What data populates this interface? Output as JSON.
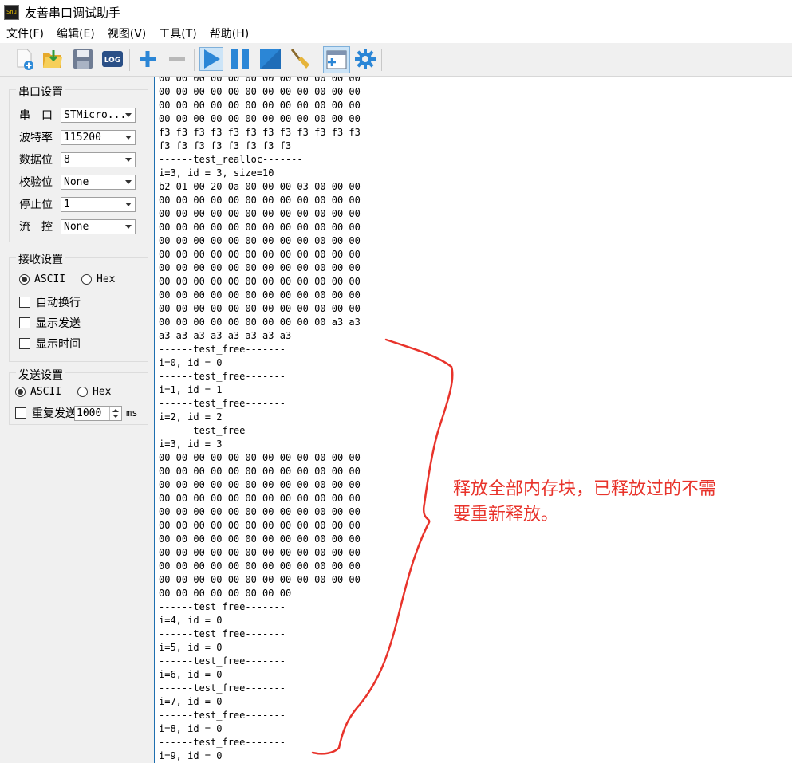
{
  "window": {
    "title": "友善串口调试助手",
    "icon_text": "Snu"
  },
  "menu": {
    "items": [
      "文件(F)",
      "编辑(E)",
      "视图(V)",
      "工具(T)",
      "帮助(H)"
    ]
  },
  "toolbar": {
    "buttons": [
      "new-file-icon",
      "open-folder-icon",
      "save-icon",
      "log-icon",
      "add-icon",
      "remove-icon",
      "start-icon",
      "pause-icon",
      "stop-icon",
      "clear-broom-icon",
      "add-window-icon",
      "settings-gear-icon"
    ],
    "log_label": "LOG"
  },
  "serial_settings": {
    "title": "串口设置",
    "port": {
      "label": "串　口",
      "value": "STMicro..."
    },
    "baud": {
      "label": "波特率",
      "value": "115200"
    },
    "data_bits": {
      "label": "数据位",
      "value": "8"
    },
    "parity": {
      "label": "校验位",
      "value": "None"
    },
    "stop_bits": {
      "label": "停止位",
      "value": "1"
    },
    "flow": {
      "label": "流　控",
      "value": "None"
    }
  },
  "receive_settings": {
    "title": "接收设置",
    "ascii": "ASCII",
    "hex": "Hex",
    "auto_wrap": "自动换行",
    "show_send": "显示发送",
    "show_time": "显示时间"
  },
  "send_settings": {
    "title": "发送设置",
    "ascii": "ASCII",
    "hex": "Hex",
    "repeat": "重复发送",
    "interval": "1000",
    "unit": "ms"
  },
  "receive_text": [
    "00 00 00 00 00 00 00 00 00 00 00 00",
    "00 00 00 00 00 00 00 00 00 00 00 00",
    "00 00 00 00 00 00 00 00 00 00 00 00",
    "00 00 00 00 00 00 00 00 00 00 00 00",
    "f3 f3 f3 f3 f3 f3 f3 f3 f3 f3 f3 f3",
    "f3 f3 f3 f3 f3 f3 f3 f3",
    "------test_realloc-------",
    "i=3, id = 3, size=10",
    "b2 01 00 20 0a 00 00 00 03 00 00 00",
    "00 00 00 00 00 00 00 00 00 00 00 00",
    "00 00 00 00 00 00 00 00 00 00 00 00",
    "00 00 00 00 00 00 00 00 00 00 00 00",
    "00 00 00 00 00 00 00 00 00 00 00 00",
    "00 00 00 00 00 00 00 00 00 00 00 00",
    "00 00 00 00 00 00 00 00 00 00 00 00",
    "00 00 00 00 00 00 00 00 00 00 00 00",
    "00 00 00 00 00 00 00 00 00 00 00 00",
    "00 00 00 00 00 00 00 00 00 00 00 00",
    "00 00 00 00 00 00 00 00 00 00 a3 a3",
    "a3 a3 a3 a3 a3 a3 a3 a3",
    "------test_free-------",
    "i=0, id = 0",
    "------test_free-------",
    "i=1, id = 1",
    "------test_free-------",
    "i=2, id = 2",
    "------test_free-------",
    "i=3, id = 3",
    "00 00 00 00 00 00 00 00 00 00 00 00",
    "00 00 00 00 00 00 00 00 00 00 00 00",
    "00 00 00 00 00 00 00 00 00 00 00 00",
    "00 00 00 00 00 00 00 00 00 00 00 00",
    "00 00 00 00 00 00 00 00 00 00 00 00",
    "00 00 00 00 00 00 00 00 00 00 00 00",
    "00 00 00 00 00 00 00 00 00 00 00 00",
    "00 00 00 00 00 00 00 00 00 00 00 00",
    "00 00 00 00 00 00 00 00 00 00 00 00",
    "00 00 00 00 00 00 00 00 00 00 00 00",
    "00 00 00 00 00 00 00 00",
    "------test_free-------",
    "i=4, id = 0",
    "------test_free-------",
    "i=5, id = 0",
    "------test_free-------",
    "i=6, id = 0",
    "------test_free-------",
    "i=7, id = 0",
    "------test_free-------",
    "i=8, id = 0",
    "------test_free-------",
    "i=9, id = 0"
  ],
  "annotation": {
    "line1": "释放全部内存块，已释放过的不需",
    "line2": "要重新释放。",
    "color": "#e8332b"
  },
  "colors": {
    "accent_blue": "#1e6fb0",
    "pressed_bg": "#cce4f7"
  }
}
